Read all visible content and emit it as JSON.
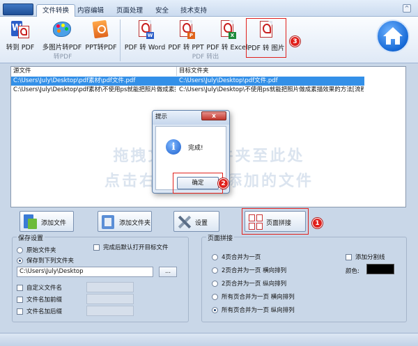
{
  "tabs": [
    {
      "label": "文件转换",
      "active": true
    },
    {
      "label": "内容编辑",
      "active": false
    },
    {
      "label": "页面处理",
      "active": false
    },
    {
      "label": "安全",
      "active": false
    },
    {
      "label": "技术支持",
      "active": false
    }
  ],
  "ribbon": {
    "group1": {
      "label": "转PDF",
      "buttons": [
        {
          "label": "转到 PDF",
          "icon": "word-to-pdf-icon"
        },
        {
          "label": "多图片转PDF",
          "icon": "palette-icon"
        },
        {
          "label": "PPT转PDF",
          "icon": "ppt-icon"
        }
      ]
    },
    "group2": {
      "label": "PDF 转出",
      "buttons": [
        {
          "label": "PDF 转 Word",
          "icon": "pdf-word-icon",
          "badge": "W"
        },
        {
          "label": "PDF 转 PPT",
          "icon": "pdf-ppt-icon",
          "badge": "P"
        },
        {
          "label": "PDF 转 Excel",
          "icon": "pdf-excel-icon",
          "badge": "X"
        },
        {
          "label": "PDF 转 图片",
          "icon": "pdf-image-icon"
        }
      ]
    }
  },
  "filelist": {
    "col_source": "源文件",
    "col_target": "目标文件夹",
    "rows": [
      {
        "source": "C:\\Users\\July\\Desktop\\pdf素材\\pdf文件.pdf",
        "target": "C:\\Users\\July\\Desktop\\pdf文件.pdf",
        "selected": true
      },
      {
        "source": "C:\\Users\\July\\Desktop\\pdf素材\\不使用ps就能把照片做成素描...",
        "target": "C:\\Users\\July\\Desktop\\不使用ps就能把照片做成素描效果的方法[流程图...",
        "selected": false
      }
    ],
    "hint_line1": "拖拽文件或文件夹至此处",
    "hint_line2": "点击右键或按钮添加的文件"
  },
  "dialog": {
    "title": "提示",
    "close": "x",
    "message": "完成!",
    "ok": "确定"
  },
  "callouts": [
    "1",
    "2",
    "3"
  ],
  "buttons": {
    "add_file": "添加文件",
    "add_folder": "添加文件夹",
    "settings": "设置",
    "page_layout": "页面拼接"
  },
  "save": {
    "title": "保存设置",
    "original_folder": "原始文件夹",
    "save_to_folder": "保存到下列文件夹",
    "open_after": "完成后默认打开目标文件",
    "path": "C:\\Users\\July\\Desktop",
    "browse": "...",
    "custom_name": "自定义文件名",
    "name_prefix": "文件名加前缀",
    "name_suffix": "文件名加后缀"
  },
  "layout": {
    "title": "页面拼接",
    "options": [
      {
        "label": "4页合并为一页",
        "checked": false
      },
      {
        "label": "2页合并为一页   横向排列",
        "checked": false
      },
      {
        "label": "2页合并为一页   纵向排列",
        "checked": false
      },
      {
        "label": "所有页合并为一页 横向排列",
        "checked": false
      },
      {
        "label": "所有页合并为一页 纵向排列",
        "checked": true
      }
    ],
    "add_divider": "添加分割线",
    "color_label": "颜色:",
    "color_value": "#000000"
  },
  "colors": {
    "accent": "#3390e8",
    "highlight": "#e0201c"
  }
}
